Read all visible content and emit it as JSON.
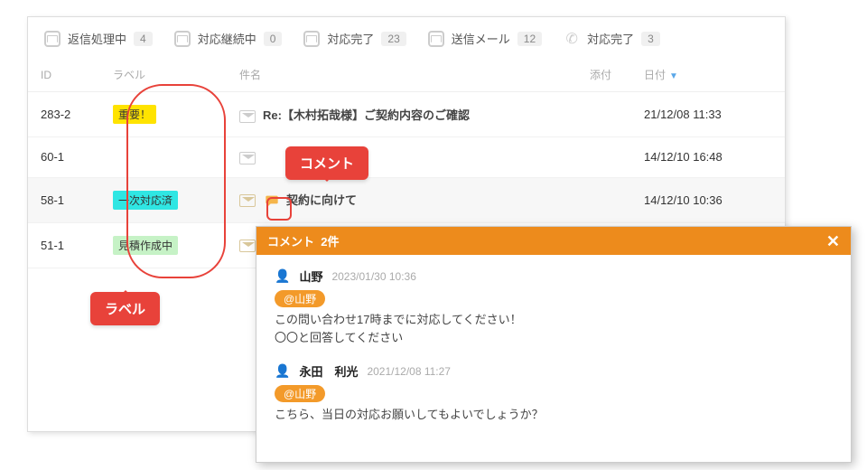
{
  "tabs": [
    {
      "label": "返信処理中",
      "count": "4",
      "icon": "mail"
    },
    {
      "label": "対応継続中",
      "count": "0",
      "icon": "mail"
    },
    {
      "label": "対応完了",
      "count": "23",
      "icon": "mail"
    },
    {
      "label": "送信メール",
      "count": "12",
      "icon": "mail"
    },
    {
      "label": "対応完了",
      "count": "3",
      "icon": "phone"
    }
  ],
  "columns": {
    "id": "ID",
    "label": "ラベル",
    "subject": "件名",
    "attachment": "添付",
    "date": "日付"
  },
  "rows": [
    {
      "id": "283-2",
      "label": {
        "text": "重要！",
        "color": "yellow"
      },
      "subject": "Re:【木村拓哉様】ご契約内容のご確認",
      "env": "closed",
      "has_comment": false,
      "date": "21/12/08 11:33"
    },
    {
      "id": "60-1",
      "label": null,
      "subject": "",
      "env": "closed",
      "has_comment": false,
      "date": "14/12/10 16:48"
    },
    {
      "id": "58-1",
      "label": {
        "text": "一次対応済",
        "color": "cyan"
      },
      "subject": "契約に向けて",
      "env": "open",
      "has_comment": true,
      "date": "14/12/10 10:36",
      "selected": true
    },
    {
      "id": "51-1",
      "label": {
        "text": "見積作成中",
        "color": "green"
      },
      "subject": "",
      "env": "open",
      "has_comment": false,
      "date": ""
    }
  ],
  "callouts": {
    "label": "ラベル",
    "comment": "コメント"
  },
  "popup": {
    "title_prefix": "コメント",
    "count_suffix": "2件",
    "comments": [
      {
        "author": "山野",
        "ts": "2023/01/30 10:36",
        "mention": "@山野",
        "lines": [
          "この問い合わせ17時までに対応してください！",
          "〇〇と回答してください"
        ]
      },
      {
        "author": "永田　利光",
        "ts": "2021/12/08 11:27",
        "mention": "@山野",
        "lines": [
          "こちら、当日の対応お願いしてもよいでしょうか？"
        ]
      }
    ]
  }
}
